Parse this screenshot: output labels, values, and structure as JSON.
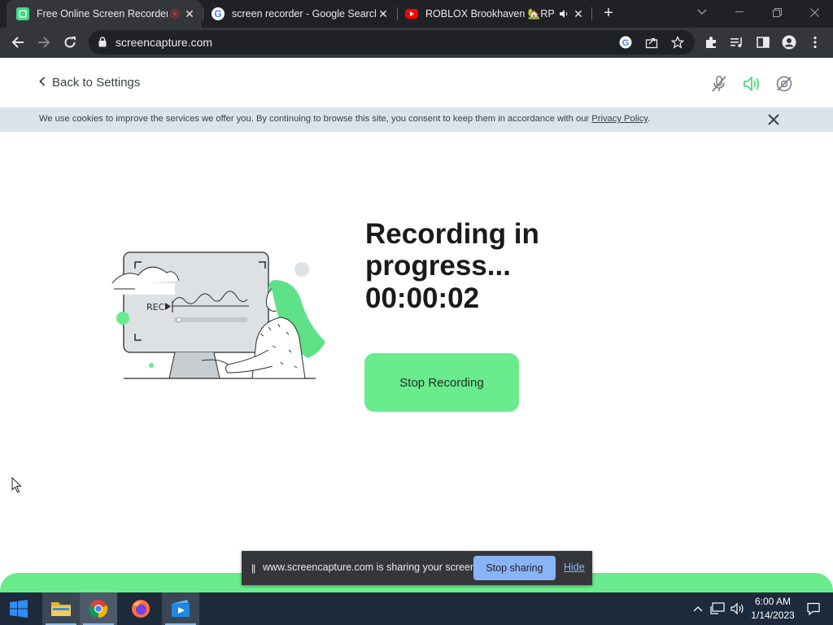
{
  "browser": {
    "tabs": [
      {
        "title": "Free Online Screen Recorder",
        "active": true,
        "favicon": "screencapture-icon",
        "indicator": "recording-dot-icon"
      },
      {
        "title": "screen recorder - Google Search",
        "active": false,
        "favicon": "google-icon"
      },
      {
        "title": "ROBLOX Brookhaven 🏡RP -",
        "active": false,
        "favicon": "youtube-icon",
        "indicator": "audio-playing-icon"
      }
    ],
    "url": "screencapture.com",
    "window_controls": [
      "tab-search",
      "minimize",
      "restore",
      "close"
    ]
  },
  "header": {
    "back_label": "Back to Settings",
    "icons": [
      "mic-off-icon",
      "speaker-on-icon",
      "camera-off-icon"
    ],
    "accent": "#6aeb8d"
  },
  "cookie": {
    "text": "We use cookies to improve the services we offer you. By continuing to browse this site, you consent to keep them in accordance with our",
    "link": "Privacy Policy",
    "end": "."
  },
  "recording": {
    "illustration_label": "REC",
    "title": "Recording in progress...",
    "timer": "00:00:02",
    "stop_label": "Stop Recording"
  },
  "share_notice": {
    "grip": "||",
    "message": "www.screencapture.com is sharing your screen.",
    "stop_label": "Stop sharing",
    "hide_label": "Hide"
  },
  "taskbar": {
    "apps": [
      "file-explorer-icon",
      "chrome-icon",
      "firefox-icon",
      "screen-recorder-app-icon"
    ],
    "time": "6:00 AM",
    "date": "1/14/2023"
  }
}
